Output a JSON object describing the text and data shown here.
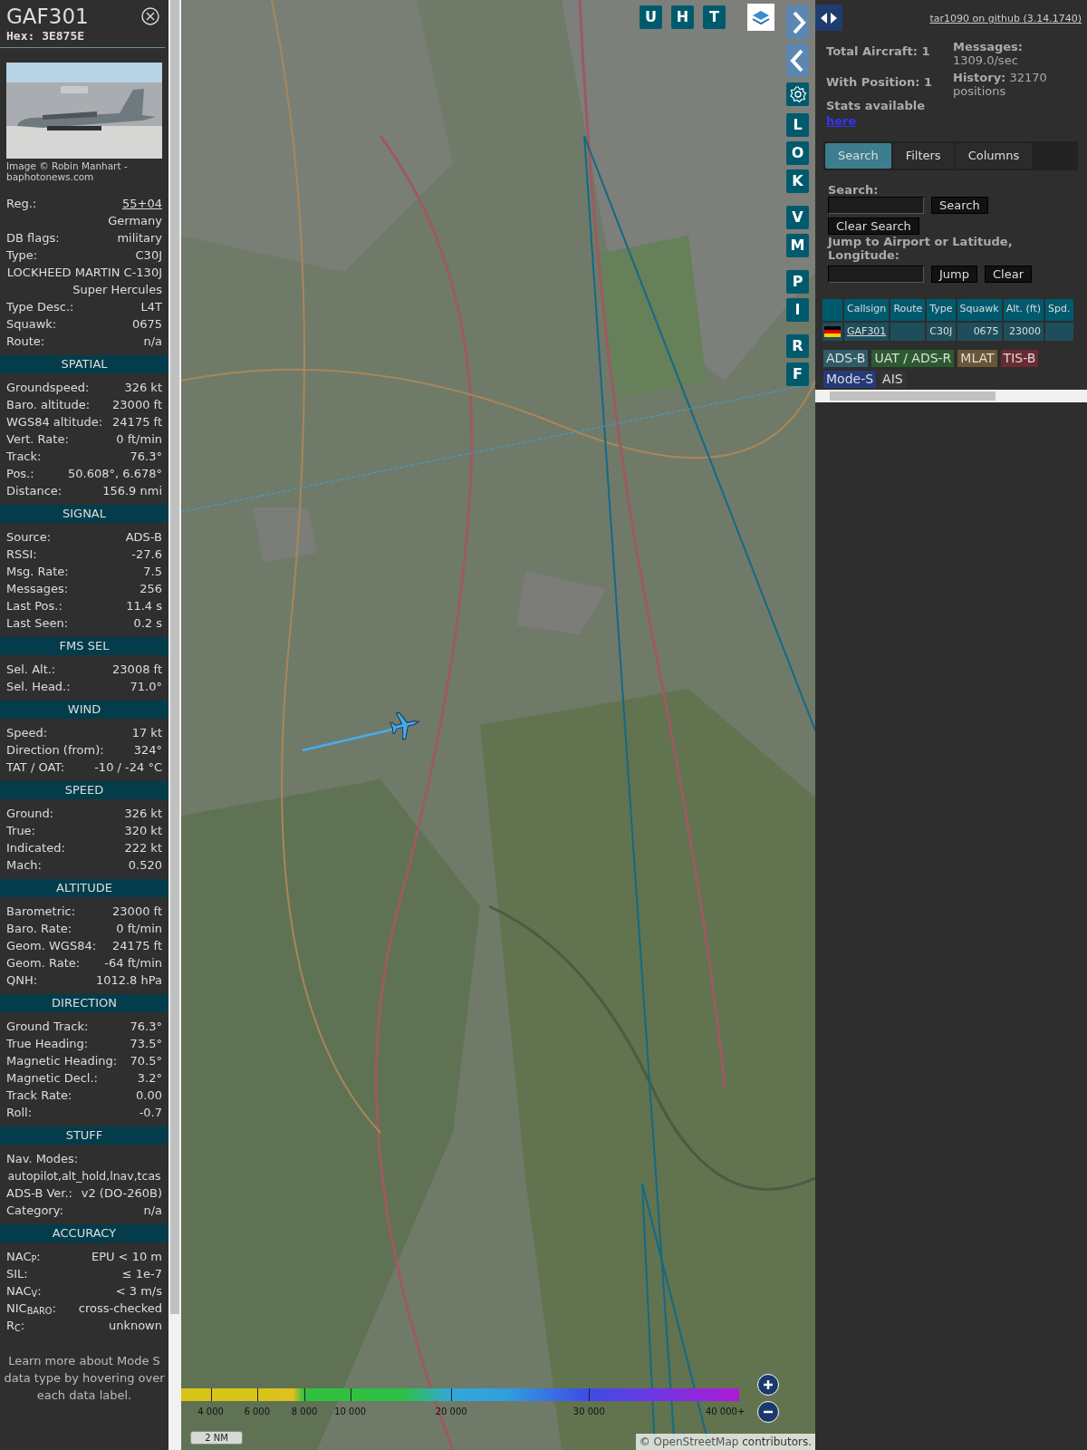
{
  "aircraft": {
    "callsign": "GAF301",
    "hex": "Hex: 3E875E",
    "photo_credit": "Image © Robin Manhart - baphotonews.com"
  },
  "details": [
    {
      "kind": "link",
      "label": "Reg.:",
      "value": "55+04"
    },
    {
      "kind": "value",
      "value": "Germany"
    },
    {
      "kind": "pair",
      "label": "DB flags:",
      "value": "military"
    },
    {
      "kind": "pair",
      "label": "Type:",
      "value": "C30J"
    },
    {
      "kind": "value",
      "value": "LOCKHEED MARTIN C-130J Super Hercules"
    },
    {
      "kind": "pair",
      "label": "Type Desc.:",
      "value": "L4T"
    },
    {
      "kind": "pair",
      "label": "Squawk:",
      "value": "0675"
    },
    {
      "kind": "pair",
      "label": "Route:",
      "value": "n/a"
    }
  ],
  "sections": [
    {
      "title": "SPATIAL",
      "rows": [
        {
          "kind": "pair",
          "label": "Groundspeed:",
          "value": "326 kt"
        },
        {
          "kind": "pair",
          "label": "Baro. altitude:",
          "value": "23000 ft"
        },
        {
          "kind": "pair",
          "label": "WGS84 altitude:",
          "value": "24175 ft"
        },
        {
          "kind": "pair",
          "label": "Vert. Rate:",
          "value": "0 ft/min"
        },
        {
          "kind": "pair",
          "label": "Track:",
          "value": "76.3°"
        },
        {
          "kind": "pair",
          "label": "Pos.:",
          "value": "50.608°, 6.678°"
        },
        {
          "kind": "pair",
          "label": "Distance:",
          "value": "156.9 nmi"
        }
      ]
    },
    {
      "title": "SIGNAL",
      "rows": [
        {
          "kind": "pair",
          "label": "Source:",
          "value": "ADS-B"
        },
        {
          "kind": "pair",
          "label": "RSSI:",
          "value": "-27.6"
        },
        {
          "kind": "pair",
          "label": "Msg. Rate:",
          "value": "7.5"
        },
        {
          "kind": "pair",
          "label": "Messages:",
          "value": "256"
        },
        {
          "kind": "pair",
          "label": "Last Pos.:",
          "value": "11.4 s"
        },
        {
          "kind": "pair",
          "label": "Last Seen:",
          "value": "0.2 s"
        }
      ]
    },
    {
      "title": "FMS SEL",
      "rows": [
        {
          "kind": "pair",
          "label": "Sel. Alt.:",
          "value": "23008 ft"
        },
        {
          "kind": "pair",
          "label": "Sel. Head.:",
          "value": "71.0°"
        }
      ]
    },
    {
      "title": "WIND",
      "rows": [
        {
          "kind": "pair",
          "label": "Speed:",
          "value": "17 kt"
        },
        {
          "kind": "pair",
          "label": "Direction (from):",
          "value": "324°"
        },
        {
          "kind": "pair",
          "label": "TAT / OAT:",
          "value": "-10 / -24 °C"
        }
      ]
    },
    {
      "title": "SPEED",
      "rows": [
        {
          "kind": "pair",
          "label": "Ground:",
          "value": "326 kt"
        },
        {
          "kind": "pair",
          "label": "True:",
          "value": "320 kt"
        },
        {
          "kind": "pair",
          "label": "Indicated:",
          "value": "222 kt"
        },
        {
          "kind": "pair",
          "label": "Mach:",
          "value": "0.520"
        }
      ]
    },
    {
      "title": "ALTITUDE",
      "rows": [
        {
          "kind": "pair",
          "label": "Barometric:",
          "value": "23000 ft"
        },
        {
          "kind": "pair",
          "label": "Baro. Rate:",
          "value": "0 ft/min"
        },
        {
          "kind": "pair",
          "label": "Geom. WGS84:",
          "value": "24175 ft"
        },
        {
          "kind": "pair",
          "label": "Geom. Rate:",
          "value": "-64 ft/min"
        },
        {
          "kind": "pair",
          "label": "QNH:",
          "value": "1012.8 hPa"
        }
      ]
    },
    {
      "title": "DIRECTION",
      "rows": [
        {
          "kind": "pair",
          "label": "Ground Track:",
          "value": "76.3°"
        },
        {
          "kind": "pair",
          "label": "True Heading:",
          "value": "73.5°"
        },
        {
          "kind": "pair",
          "label": "Magnetic Heading:",
          "value": "70.5°"
        },
        {
          "kind": "pair",
          "label": "Magnetic Decl.:",
          "value": "3.2°"
        },
        {
          "kind": "pair",
          "label": "Track Rate:",
          "value": "0.00"
        },
        {
          "kind": "pair",
          "label": "Roll:",
          "value": "-0.7"
        }
      ]
    },
    {
      "title": "STUFF",
      "rows": [
        {
          "kind": "label",
          "label": "Nav. Modes:"
        },
        {
          "kind": "wide",
          "value": "autopilot,alt_hold,lnav,tcas"
        },
        {
          "kind": "pair",
          "label": "ADS-B Ver.:",
          "value": "v2 (DO-260B)"
        },
        {
          "kind": "pair",
          "label": "Category:",
          "value": "n/a"
        }
      ]
    },
    {
      "title": "ACCURACY",
      "rows": [
        {
          "kind": "pair",
          "label": "NAC$_{P}$:",
          "value": "EPU < 10 m"
        },
        {
          "kind": "pair",
          "label": "SIL:",
          "value": "≤ 1e-7"
        },
        {
          "kind": "pair",
          "label": "NAC$_{V}$:",
          "value": "< 3 m/s"
        },
        {
          "kind": "pair",
          "label": "NIC$_{BARO}$:",
          "value": "cross-checked"
        },
        {
          "kind": "pair",
          "label": "R$_{C}$:",
          "value": "unknown"
        }
      ]
    }
  ],
  "footer_note": "Learn more about Mode S data type by hovering over each data label.",
  "map": {
    "top_buttons": [
      "U",
      "H",
      "T"
    ],
    "side_buttons": [
      [
        {
          "kind": "next"
        },
        {
          "kind": "prev"
        }
      ],
      [
        {
          "kind": "settings"
        }
      ],
      [
        {
          "kind": "letter",
          "label": "L"
        },
        {
          "kind": "letter",
          "label": "O"
        },
        {
          "kind": "letter",
          "label": "K"
        }
      ],
      [
        {
          "kind": "letter",
          "label": "V"
        },
        {
          "kind": "letter",
          "label": "M"
        }
      ],
      [
        {
          "kind": "letter",
          "label": "P"
        },
        {
          "kind": "letter",
          "label": "I"
        }
      ],
      [
        {
          "kind": "letter",
          "label": "R"
        },
        {
          "kind": "letter",
          "label": "F"
        }
      ]
    ],
    "altitude_legend": [
      "4 000",
      "6 000",
      "8 000",
      "10 000",
      "20 000",
      "30 000",
      "40 000+"
    ],
    "scale": "2 NM",
    "attribution": {
      "prefix": "©",
      "link": "OpenStreetMap",
      "suffix": "contributors."
    }
  },
  "panel": {
    "github_link": "tar1090 on github (3.14.1740)",
    "stats_left": [
      "Total Aircraft: 1",
      "With Position: 1",
      "Stats available"
    ],
    "stats_link": "here",
    "stats_right": [
      "**Messages:** 1309.0/sec",
      "**History:** 32170 positions"
    ],
    "tabs": [
      {
        "label": "Search",
        "selected": true
      },
      {
        "label": "Filters",
        "selected": false
      },
      {
        "label": "Columns",
        "selected": false
      }
    ],
    "search_label": "Search:",
    "search_button": "Search",
    "clear_search_button": "Clear Search",
    "jump_label": "Jump to Airport or Latitude, Longitude:",
    "jump_button": "Jump",
    "clear_button": "Clear",
    "columns": [
      "Callsign",
      "Route",
      "Type",
      "Squawk",
      "Alt. (ft)",
      "Spd."
    ],
    "rows": [
      {
        "callsign": "GAF301",
        "type": "C30J",
        "squawk": "0675",
        "altitude": "23000"
      }
    ],
    "legend": [
      {
        "label": "ADS-B",
        "color": "#2f5b68"
      },
      {
        "label": "UAT / ADS-R",
        "color": "#2c5a30"
      },
      {
        "label": "MLAT",
        "color": "#6a5634"
      },
      {
        "label": "TIS-B",
        "color": "#6a2a32"
      },
      {
        "label": "Mode-S",
        "color": "#253a7a"
      },
      {
        "label": "AIS",
        "color": "#353535"
      }
    ]
  }
}
